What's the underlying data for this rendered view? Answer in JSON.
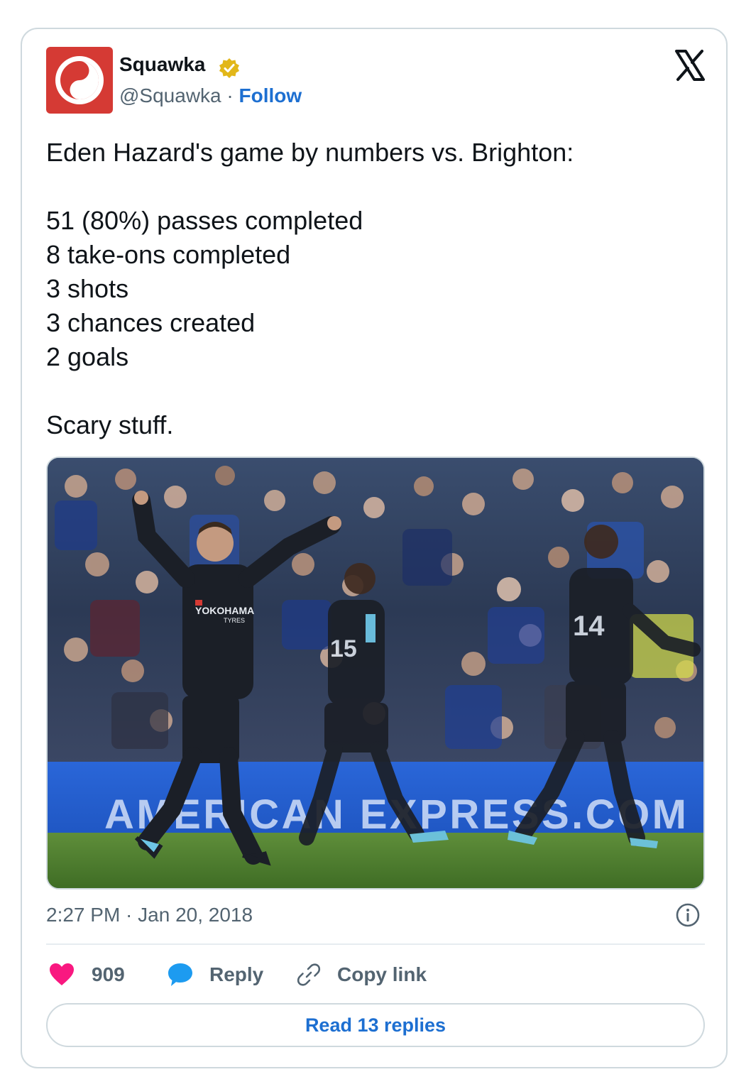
{
  "header": {
    "display_name": "Squawka",
    "handle": "@Squawka",
    "separator": "·",
    "follow_label": "Follow",
    "verified": true
  },
  "tweet": {
    "lines": [
      "Eden Hazard's game by numbers vs. Brighton:",
      "",
      "51 (80%) passes completed",
      "8 take-ons completed",
      "3 shots",
      "3 chances created",
      "2 goals",
      "",
      "Scary stuff."
    ]
  },
  "media": {
    "ad_board_text": "AMERICAN EXPRESS.COM",
    "shirt_sponsor": "YOKOHAMA",
    "shirt_sponsor_sub": "TYRES",
    "player_numbers": [
      "15",
      "14"
    ]
  },
  "footer": {
    "timestamp": "2:27 PM · Jan 20, 2018",
    "like_count": "909",
    "reply_label": "Reply",
    "copy_link_label": "Copy link",
    "read_replies_label": "Read 13 replies"
  },
  "colors": {
    "brand_red": "#d53a34",
    "link_blue": "#1d6fd1",
    "like_pink": "#f91880",
    "reply_blue": "#1d9bf0",
    "muted_text": "#536471",
    "border": "#cfd9de",
    "verified_gold": "#e2b719"
  },
  "icons": {
    "avatar": "squawka-logo-icon",
    "verified": "verified-badge-icon",
    "brand": "x-logo-icon",
    "info": "info-icon",
    "like": "heart-icon",
    "reply": "speech-bubble-icon",
    "copy": "link-icon"
  }
}
